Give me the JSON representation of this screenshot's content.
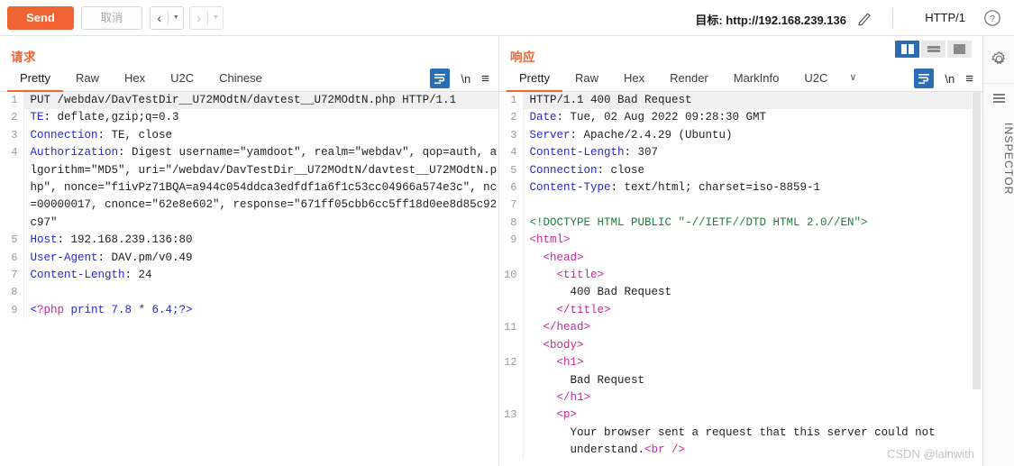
{
  "toolbar": {
    "send_label": "Send",
    "cancel_label": "取消",
    "prev_arrow": "‹",
    "next_arrow": "›",
    "caret": "▼",
    "target_label": "目标: http://192.168.239.136",
    "pencil_icon": "pencil-icon",
    "http_version": "HTTP/1",
    "help_icon": "help-icon"
  },
  "request": {
    "title": "请求",
    "tabs": [
      {
        "label": "Pretty",
        "active": true
      },
      {
        "label": "Raw",
        "active": false
      },
      {
        "label": "Hex",
        "active": false
      },
      {
        "label": "U2C",
        "active": false
      },
      {
        "label": "Chinese",
        "active": false
      }
    ],
    "tools": {
      "wrap_icon": "word-wrap-icon",
      "newline_label": "\\n",
      "menu_icon": "hamburger-menu-icon"
    },
    "lines": [
      {
        "num": "1",
        "first": true,
        "segments": [
          {
            "cls": "plain",
            "text": "PUT /webdav/DavTestDir__U72MOdtN/davtest__U72MOdtN.php HTTP/1.1"
          }
        ]
      },
      {
        "num": "2",
        "segments": [
          {
            "cls": "hdr-name",
            "text": "TE"
          },
          {
            "cls": "plain",
            "text": ": deflate,gzip;q=0.3"
          }
        ]
      },
      {
        "num": "3",
        "segments": [
          {
            "cls": "hdr-name",
            "text": "Connection"
          },
          {
            "cls": "plain",
            "text": ": TE, close"
          }
        ]
      },
      {
        "num": "4",
        "segments": [
          {
            "cls": "hdr-name",
            "text": "Authorization"
          },
          {
            "cls": "plain",
            "text": ": Digest username=\"yamdoot\", realm=\"webdav\", qop=auth, algorithm=\"MD5\", uri=\"/webdav/DavTestDir__U72MOdtN/davtest__U72MOdtN.php\", nonce=\"f1ivPz71BQA=a944c054ddca3edfdf1a6f1c53cc04966a574e3c\", nc=00000017, cnonce=\"62e8e602\", response=\"671ff05cbb6cc5ff18d0ee8d85c92c97\""
          }
        ]
      },
      {
        "num": "5",
        "segments": [
          {
            "cls": "hdr-name",
            "text": "Host"
          },
          {
            "cls": "plain",
            "text": ": 192.168.239.136:80"
          }
        ]
      },
      {
        "num": "6",
        "segments": [
          {
            "cls": "hdr-name",
            "text": "User-Agent"
          },
          {
            "cls": "plain",
            "text": ": DAV.pm/v0.49"
          }
        ]
      },
      {
        "num": "7",
        "segments": [
          {
            "cls": "hdr-name",
            "text": "Content-Length"
          },
          {
            "cls": "plain",
            "text": ": 24"
          }
        ]
      },
      {
        "num": "8",
        "segments": [
          {
            "cls": "plain",
            "text": ""
          }
        ]
      },
      {
        "num": "9",
        "segments": [
          {
            "cls": "hdr-name",
            "text": "<"
          },
          {
            "cls": "tag",
            "text": "?php"
          },
          {
            "cls": "hdr-name",
            "text": " print 7.8 * 6.4;?>"
          }
        ]
      }
    ]
  },
  "response": {
    "title": "响应",
    "tabs": [
      {
        "label": "Pretty",
        "active": true
      },
      {
        "label": "Raw",
        "active": false
      },
      {
        "label": "Hex",
        "active": false
      },
      {
        "label": "Render",
        "active": false
      },
      {
        "label": "MarkInfo",
        "active": false
      },
      {
        "label": "U2C",
        "active": false
      }
    ],
    "tab_overflow_caret": "∨",
    "tools": {
      "wrap_icon": "word-wrap-icon",
      "newline_label": "\\n",
      "menu_icon": "hamburger-menu-icon"
    },
    "layout_buttons": [
      {
        "name": "split-vertical",
        "active": true
      },
      {
        "name": "split-horizontal",
        "active": false
      },
      {
        "name": "single-pane",
        "active": false
      }
    ],
    "lines": [
      {
        "num": "1",
        "first": true,
        "segments": [
          {
            "cls": "plain",
            "text": "HTTP/1.1 400 Bad Request"
          }
        ]
      },
      {
        "num": "2",
        "segments": [
          {
            "cls": "hdr-name",
            "text": "Date"
          },
          {
            "cls": "plain",
            "text": ": Tue, 02 Aug 2022 09:28:30 GMT"
          }
        ]
      },
      {
        "num": "3",
        "segments": [
          {
            "cls": "hdr-name",
            "text": "Server"
          },
          {
            "cls": "plain",
            "text": ": Apache/2.4.29 (Ubuntu)"
          }
        ]
      },
      {
        "num": "4",
        "segments": [
          {
            "cls": "hdr-name",
            "text": "Content-Length"
          },
          {
            "cls": "plain",
            "text": ": 307"
          }
        ]
      },
      {
        "num": "5",
        "segments": [
          {
            "cls": "hdr-name",
            "text": "Connection"
          },
          {
            "cls": "plain",
            "text": ": close"
          }
        ]
      },
      {
        "num": "6",
        "segments": [
          {
            "cls": "hdr-name",
            "text": "Content-Type"
          },
          {
            "cls": "plain",
            "text": ": text/html; charset=iso-8859-1"
          }
        ]
      },
      {
        "num": "7",
        "segments": [
          {
            "cls": "plain",
            "text": ""
          }
        ]
      },
      {
        "num": "8",
        "segments": [
          {
            "cls": "doctype",
            "text": "<!DOCTYPE HTML PUBLIC \"-//IETF//DTD HTML 2.0//EN\">"
          }
        ]
      },
      {
        "num": "9",
        "segments": [
          {
            "cls": "tag",
            "text": "<html>"
          }
        ]
      },
      {
        "num": "",
        "segments": [
          {
            "cls": "tag",
            "text": "  <head>"
          }
        ]
      },
      {
        "num": "10",
        "segments": [
          {
            "cls": "tag",
            "text": "    <title>"
          }
        ]
      },
      {
        "num": "",
        "segments": [
          {
            "cls": "plain",
            "text": "      400 Bad Request"
          }
        ]
      },
      {
        "num": "",
        "segments": [
          {
            "cls": "tag",
            "text": "    </title>"
          }
        ]
      },
      {
        "num": "11",
        "segments": [
          {
            "cls": "tag",
            "text": "  </head>"
          }
        ]
      },
      {
        "num": "",
        "segments": [
          {
            "cls": "tag",
            "text": "  <body>"
          }
        ]
      },
      {
        "num": "12",
        "segments": [
          {
            "cls": "tag",
            "text": "    <h1>"
          }
        ]
      },
      {
        "num": "",
        "segments": [
          {
            "cls": "plain",
            "text": "      Bad Request"
          }
        ]
      },
      {
        "num": "",
        "segments": [
          {
            "cls": "tag",
            "text": "    </h1>"
          }
        ]
      },
      {
        "num": "13",
        "segments": [
          {
            "cls": "tag",
            "text": "    <p>"
          }
        ]
      },
      {
        "num": "",
        "segments": [
          {
            "cls": "plain",
            "text": "      Your browser sent a request that this server could not"
          }
        ]
      },
      {
        "num": "",
        "segments": [
          {
            "cls": "plain",
            "text": "      understand."
          },
          {
            "cls": "tag",
            "text": "<br />"
          }
        ]
      }
    ]
  },
  "rail": {
    "gear_icon": "gear-icon",
    "bars_icon": "panel-bars-icon",
    "inspector_label": "INSPECTOR"
  },
  "watermark": "CSDN @lainwith",
  "colors": {
    "accent": "#f26334",
    "header_name": "#2727cd",
    "tag": "#c0299c",
    "doctype": "#1b7f3b",
    "active_toggle": "#2a6db5"
  }
}
